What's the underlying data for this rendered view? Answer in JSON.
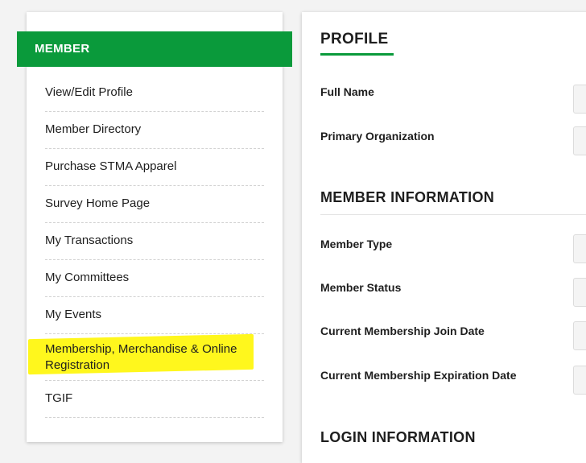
{
  "sidebar": {
    "header": "MEMBER",
    "items": [
      {
        "label": "View/Edit Profile"
      },
      {
        "label": "Member Directory"
      },
      {
        "label": "Purchase STMA Apparel"
      },
      {
        "label": "Survey Home Page"
      },
      {
        "label": "My Transactions"
      },
      {
        "label": "My Committees"
      },
      {
        "label": "My Events"
      },
      {
        "label": "Membership, Merchandise & Online Registration"
      },
      {
        "label": "TGIF"
      }
    ],
    "highlight_color": "#fff71d"
  },
  "profile": {
    "title": "PROFILE",
    "fields": [
      {
        "label": "Full Name"
      },
      {
        "label": "Primary Organization"
      }
    ]
  },
  "member_information": {
    "title": "MEMBER INFORMATION",
    "fields": [
      {
        "label": "Member Type"
      },
      {
        "label": "Member Status"
      },
      {
        "label": "Current Membership Join Date"
      },
      {
        "label": "Current Membership Expiration Date"
      }
    ]
  },
  "login_information": {
    "title": "LOGIN INFORMATION"
  },
  "colors": {
    "accent_green": "#0a9a3b",
    "text": "#1e1e1e"
  }
}
